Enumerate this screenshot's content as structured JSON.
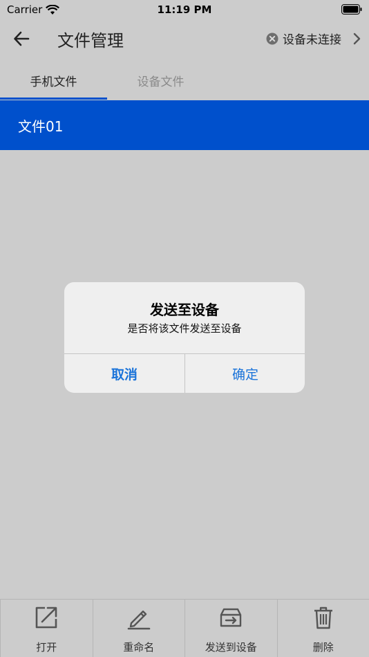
{
  "status_bar": {
    "carrier": "Carrier",
    "time": "11:19 PM"
  },
  "header": {
    "title": "文件管理",
    "connection_status": "设备未连接"
  },
  "tabs": [
    {
      "label": "手机文件",
      "active": true
    },
    {
      "label": "设备文件",
      "active": false
    }
  ],
  "files": [
    {
      "name": "文件01",
      "selected": true
    }
  ],
  "dialog": {
    "title": "发送至设备",
    "message": "是否将该文件发送至设备",
    "cancel_label": "取消",
    "confirm_label": "确定"
  },
  "toolbar": [
    {
      "label": "打开",
      "icon": "open-external-icon"
    },
    {
      "label": "重命名",
      "icon": "pencil-icon"
    },
    {
      "label": "发送到设备",
      "icon": "send-to-device-icon"
    },
    {
      "label": "删除",
      "icon": "trash-icon"
    }
  ],
  "colors": {
    "accent": "#0050cc",
    "dialog_button": "#1a73d9",
    "background_dim": "#cccccc"
  }
}
